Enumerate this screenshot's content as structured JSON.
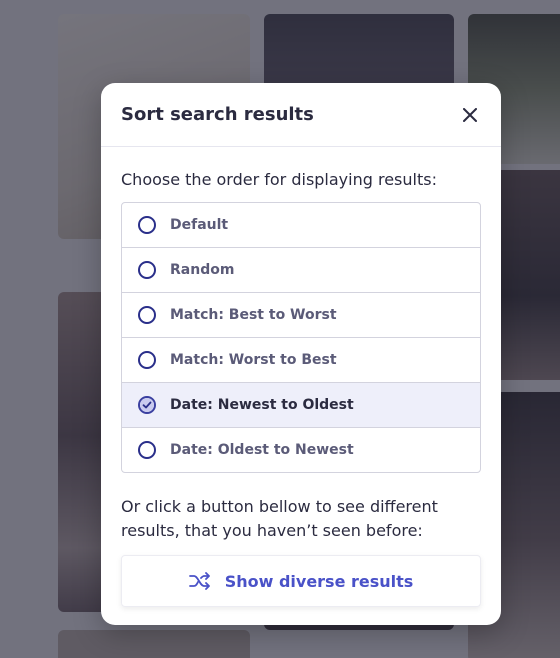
{
  "colors": {
    "accent": "#4a52c8",
    "radio_border": "#2a2f8a",
    "selected_row_bg": "#eeeffa",
    "overlay": "#28283a"
  },
  "modal": {
    "title": "Sort search results",
    "close_icon": "close-icon",
    "prompt": "Choose the order for displaying results:",
    "options": [
      {
        "label": "Default",
        "selected": false
      },
      {
        "label": "Random",
        "selected": false
      },
      {
        "label": "Match: Best to Worst",
        "selected": false
      },
      {
        "label": "Match: Worst to Best",
        "selected": false
      },
      {
        "label": "Date: Newest to Oldest",
        "selected": true
      },
      {
        "label": "Date: Oldest to Newest",
        "selected": false
      }
    ],
    "hint": "Or click a button bellow to see different results, that you haven’t seen before:",
    "diverse_button": {
      "icon": "shuffle-icon",
      "label": "Show diverse results"
    }
  }
}
